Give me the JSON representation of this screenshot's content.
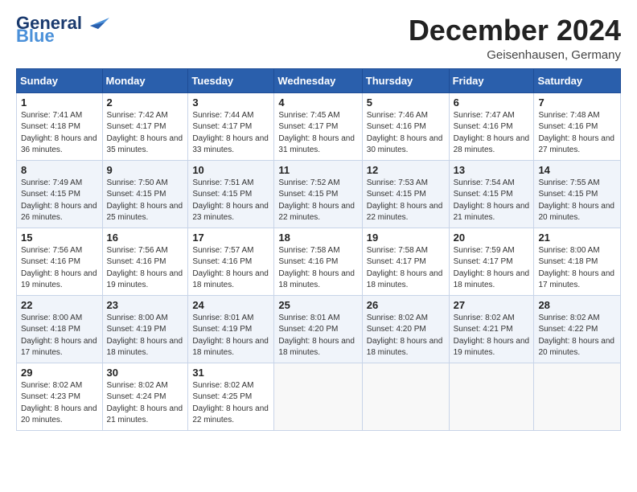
{
  "header": {
    "logo_general": "General",
    "logo_blue": "Blue",
    "month_title": "December 2024",
    "location": "Geisenhausen, Germany"
  },
  "weekdays": [
    "Sunday",
    "Monday",
    "Tuesday",
    "Wednesday",
    "Thursday",
    "Friday",
    "Saturday"
  ],
  "weeks": [
    [
      {
        "day": "1",
        "sunrise": "Sunrise: 7:41 AM",
        "sunset": "Sunset: 4:18 PM",
        "daylight": "Daylight: 8 hours and 36 minutes."
      },
      {
        "day": "2",
        "sunrise": "Sunrise: 7:42 AM",
        "sunset": "Sunset: 4:17 PM",
        "daylight": "Daylight: 8 hours and 35 minutes."
      },
      {
        "day": "3",
        "sunrise": "Sunrise: 7:44 AM",
        "sunset": "Sunset: 4:17 PM",
        "daylight": "Daylight: 8 hours and 33 minutes."
      },
      {
        "day": "4",
        "sunrise": "Sunrise: 7:45 AM",
        "sunset": "Sunset: 4:17 PM",
        "daylight": "Daylight: 8 hours and 31 minutes."
      },
      {
        "day": "5",
        "sunrise": "Sunrise: 7:46 AM",
        "sunset": "Sunset: 4:16 PM",
        "daylight": "Daylight: 8 hours and 30 minutes."
      },
      {
        "day": "6",
        "sunrise": "Sunrise: 7:47 AM",
        "sunset": "Sunset: 4:16 PM",
        "daylight": "Daylight: 8 hours and 28 minutes."
      },
      {
        "day": "7",
        "sunrise": "Sunrise: 7:48 AM",
        "sunset": "Sunset: 4:16 PM",
        "daylight": "Daylight: 8 hours and 27 minutes."
      }
    ],
    [
      {
        "day": "8",
        "sunrise": "Sunrise: 7:49 AM",
        "sunset": "Sunset: 4:15 PM",
        "daylight": "Daylight: 8 hours and 26 minutes."
      },
      {
        "day": "9",
        "sunrise": "Sunrise: 7:50 AM",
        "sunset": "Sunset: 4:15 PM",
        "daylight": "Daylight: 8 hours and 25 minutes."
      },
      {
        "day": "10",
        "sunrise": "Sunrise: 7:51 AM",
        "sunset": "Sunset: 4:15 PM",
        "daylight": "Daylight: 8 hours and 23 minutes."
      },
      {
        "day": "11",
        "sunrise": "Sunrise: 7:52 AM",
        "sunset": "Sunset: 4:15 PM",
        "daylight": "Daylight: 8 hours and 22 minutes."
      },
      {
        "day": "12",
        "sunrise": "Sunrise: 7:53 AM",
        "sunset": "Sunset: 4:15 PM",
        "daylight": "Daylight: 8 hours and 22 minutes."
      },
      {
        "day": "13",
        "sunrise": "Sunrise: 7:54 AM",
        "sunset": "Sunset: 4:15 PM",
        "daylight": "Daylight: 8 hours and 21 minutes."
      },
      {
        "day": "14",
        "sunrise": "Sunrise: 7:55 AM",
        "sunset": "Sunset: 4:15 PM",
        "daylight": "Daylight: 8 hours and 20 minutes."
      }
    ],
    [
      {
        "day": "15",
        "sunrise": "Sunrise: 7:56 AM",
        "sunset": "Sunset: 4:16 PM",
        "daylight": "Daylight: 8 hours and 19 minutes."
      },
      {
        "day": "16",
        "sunrise": "Sunrise: 7:56 AM",
        "sunset": "Sunset: 4:16 PM",
        "daylight": "Daylight: 8 hours and 19 minutes."
      },
      {
        "day": "17",
        "sunrise": "Sunrise: 7:57 AM",
        "sunset": "Sunset: 4:16 PM",
        "daylight": "Daylight: 8 hours and 18 minutes."
      },
      {
        "day": "18",
        "sunrise": "Sunrise: 7:58 AM",
        "sunset": "Sunset: 4:16 PM",
        "daylight": "Daylight: 8 hours and 18 minutes."
      },
      {
        "day": "19",
        "sunrise": "Sunrise: 7:58 AM",
        "sunset": "Sunset: 4:17 PM",
        "daylight": "Daylight: 8 hours and 18 minutes."
      },
      {
        "day": "20",
        "sunrise": "Sunrise: 7:59 AM",
        "sunset": "Sunset: 4:17 PM",
        "daylight": "Daylight: 8 hours and 18 minutes."
      },
      {
        "day": "21",
        "sunrise": "Sunrise: 8:00 AM",
        "sunset": "Sunset: 4:18 PM",
        "daylight": "Daylight: 8 hours and 17 minutes."
      }
    ],
    [
      {
        "day": "22",
        "sunrise": "Sunrise: 8:00 AM",
        "sunset": "Sunset: 4:18 PM",
        "daylight": "Daylight: 8 hours and 17 minutes."
      },
      {
        "day": "23",
        "sunrise": "Sunrise: 8:00 AM",
        "sunset": "Sunset: 4:19 PM",
        "daylight": "Daylight: 8 hours and 18 minutes."
      },
      {
        "day": "24",
        "sunrise": "Sunrise: 8:01 AM",
        "sunset": "Sunset: 4:19 PM",
        "daylight": "Daylight: 8 hours and 18 minutes."
      },
      {
        "day": "25",
        "sunrise": "Sunrise: 8:01 AM",
        "sunset": "Sunset: 4:20 PM",
        "daylight": "Daylight: 8 hours and 18 minutes."
      },
      {
        "day": "26",
        "sunrise": "Sunrise: 8:02 AM",
        "sunset": "Sunset: 4:20 PM",
        "daylight": "Daylight: 8 hours and 18 minutes."
      },
      {
        "day": "27",
        "sunrise": "Sunrise: 8:02 AM",
        "sunset": "Sunset: 4:21 PM",
        "daylight": "Daylight: 8 hours and 19 minutes."
      },
      {
        "day": "28",
        "sunrise": "Sunrise: 8:02 AM",
        "sunset": "Sunset: 4:22 PM",
        "daylight": "Daylight: 8 hours and 20 minutes."
      }
    ],
    [
      {
        "day": "29",
        "sunrise": "Sunrise: 8:02 AM",
        "sunset": "Sunset: 4:23 PM",
        "daylight": "Daylight: 8 hours and 20 minutes."
      },
      {
        "day": "30",
        "sunrise": "Sunrise: 8:02 AM",
        "sunset": "Sunset: 4:24 PM",
        "daylight": "Daylight: 8 hours and 21 minutes."
      },
      {
        "day": "31",
        "sunrise": "Sunrise: 8:02 AM",
        "sunset": "Sunset: 4:25 PM",
        "daylight": "Daylight: 8 hours and 22 minutes."
      },
      null,
      null,
      null,
      null
    ]
  ]
}
